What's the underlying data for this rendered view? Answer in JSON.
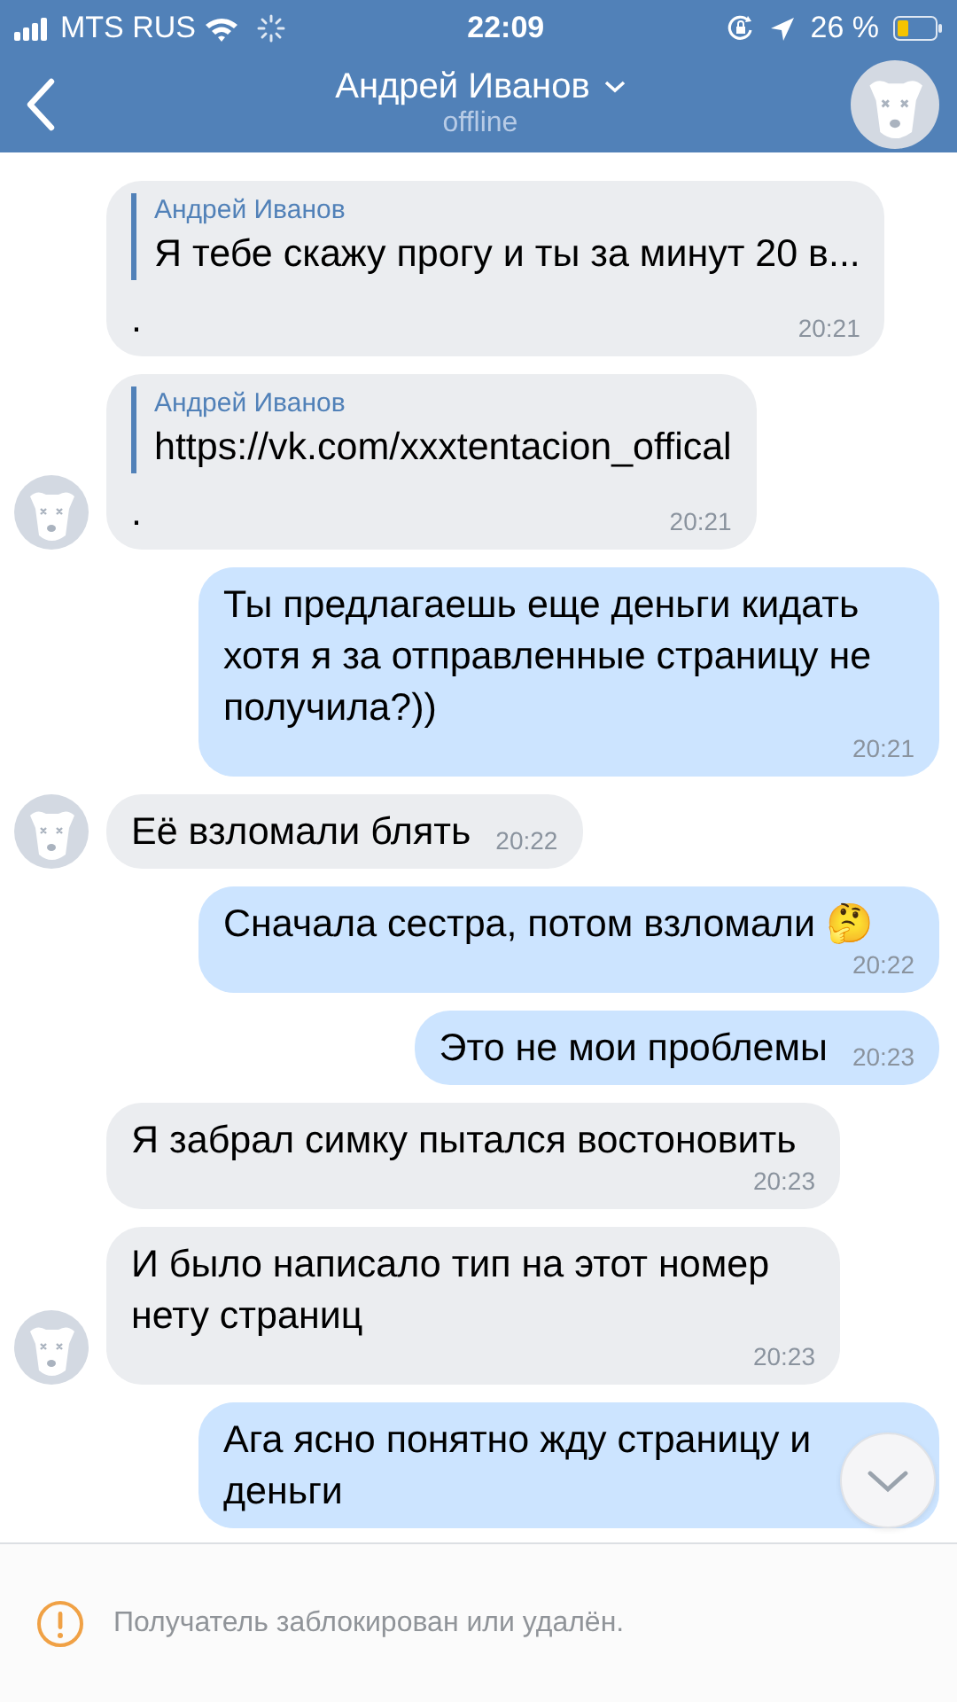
{
  "status_bar": {
    "carrier": "MTS RUS",
    "time": "22:09",
    "battery": "26 %"
  },
  "header": {
    "title": "Андрей Иванов",
    "subtitle": "offline"
  },
  "messages": [
    {
      "kind": "incoming",
      "avatar": false,
      "quote": {
        "author": "Андрей Иванов",
        "text": "Я тебе скажу прогу и ты за минут 20 в..."
      },
      "text": ".",
      "time": "20:21"
    },
    {
      "kind": "incoming",
      "avatar": true,
      "quote": {
        "author": "Андрей Иванов",
        "text": "https://vk.com/xxxtentacion_offical"
      },
      "text": ".",
      "time": "20:21"
    },
    {
      "kind": "outgoing",
      "text": "Ты предлагаешь еще деньги кидать хотя я за отправленные страницу не получила?))",
      "time": "20:21"
    },
    {
      "kind": "incoming",
      "avatar": true,
      "text": "Её взломали блять",
      "time": "20:22"
    },
    {
      "kind": "outgoing",
      "text": "Сначала сестра, потом взломали 🤔",
      "time": "20:22"
    },
    {
      "kind": "outgoing",
      "text": "Это не мои проблемы",
      "time": "20:23"
    },
    {
      "kind": "incoming",
      "avatar": false,
      "text": "Я забрал симку пытался востоновить",
      "time": "20:23"
    },
    {
      "kind": "incoming",
      "avatar": true,
      "text": "И было написало тип на этот номер нету страниц",
      "time": "20:23"
    },
    {
      "kind": "outgoing",
      "text": "Ага ясно понятно жду страницу и деньги"
    }
  ],
  "notice": {
    "text": "Получатель заблокирован или удалён."
  }
}
